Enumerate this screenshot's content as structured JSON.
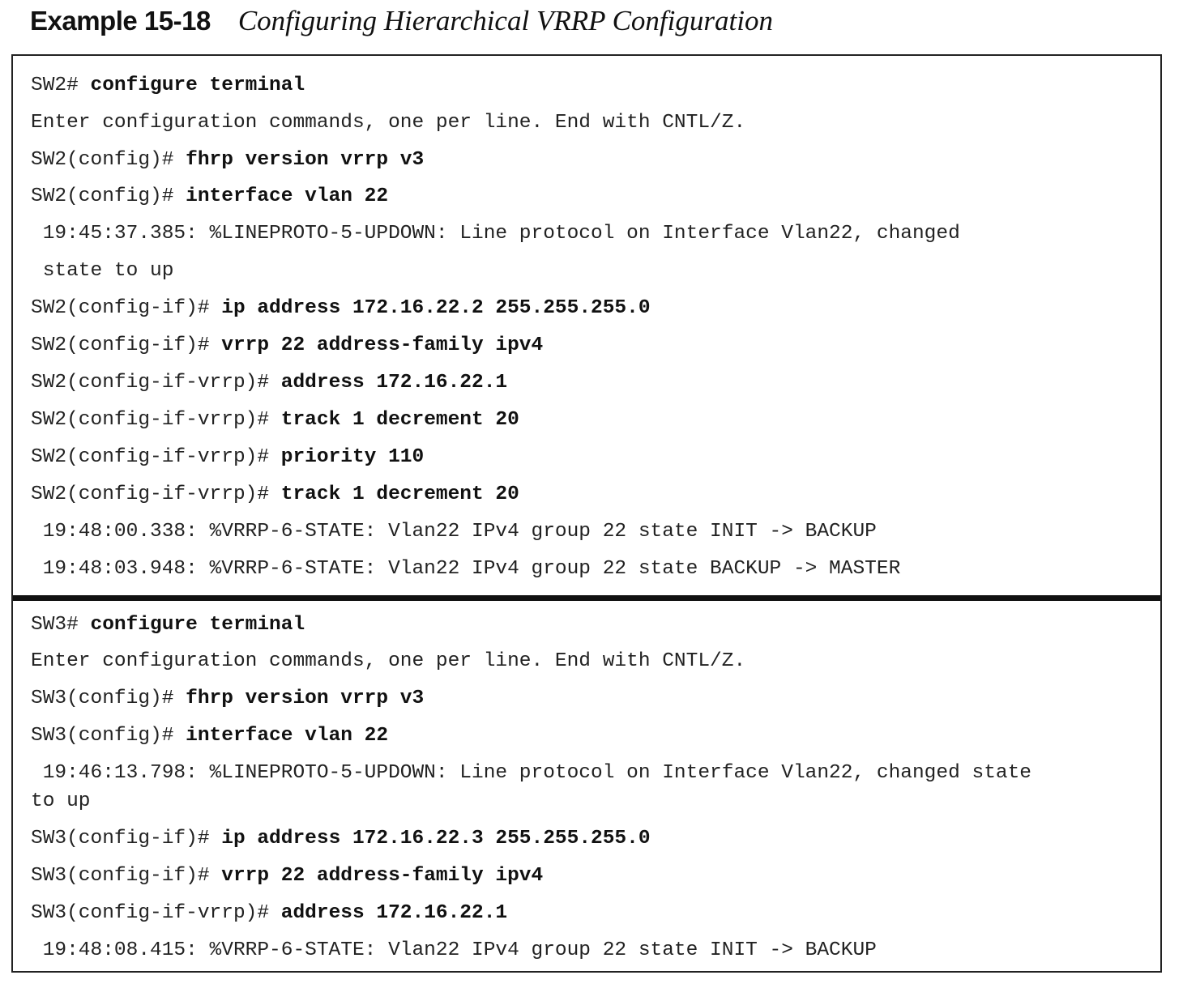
{
  "caption": {
    "label": "Example 15-18",
    "title": "Configuring Hierarchical VRRP Configuration"
  },
  "sw2": {
    "l1": {
      "prompt": "SW2# ",
      "cmd": "configure terminal"
    },
    "l2": {
      "text": "Enter configuration commands, one per line. End with CNTL/Z."
    },
    "l3": {
      "prompt": "SW2(config)# ",
      "cmd": "fhrp version vrrp v3"
    },
    "l4": {
      "prompt": "SW2(config)# ",
      "cmd": "interface vlan 22"
    },
    "l5": {
      "text": " 19:45:37.385: %LINEPROTO-5-UPDOWN: Line protocol on Interface Vlan22, changed"
    },
    "l6": {
      "text": " state to up"
    },
    "l7": {
      "prompt": "SW2(config-if)# ",
      "cmd": "ip address 172.16.22.2 255.255.255.0"
    },
    "l8": {
      "prompt": "SW2(config-if)# ",
      "cmd": "vrrp 22 address-family ipv4"
    },
    "l9": {
      "prompt": "SW2(config-if-vrrp)# ",
      "cmd": "address 172.16.22.1"
    },
    "l10": {
      "prompt": "SW2(config-if-vrrp)# ",
      "cmd": "track 1 decrement 20"
    },
    "l11": {
      "prompt": "SW2(config-if-vrrp)# ",
      "cmd": "priority 110"
    },
    "l12": {
      "prompt": "SW2(config-if-vrrp)# ",
      "cmd": "track 1 decrement 20"
    },
    "l13": {
      "text": " 19:48:00.338: %VRRP-6-STATE: Vlan22 IPv4 group 22 state INIT -> BACKUP"
    },
    "l14": {
      "text": " 19:48:03.948: %VRRP-6-STATE: Vlan22 IPv4 group 22 state BACKUP -> MASTER"
    }
  },
  "sw3": {
    "l1": {
      "prompt": "SW3# ",
      "cmd": "configure terminal"
    },
    "l2": {
      "text": "Enter configuration commands, one per line. End with CNTL/Z."
    },
    "l3": {
      "prompt": "SW3(config)# ",
      "cmd": "fhrp version vrrp v3"
    },
    "l4": {
      "prompt": "SW3(config)# ",
      "cmd": "interface vlan 22"
    },
    "l5": {
      "text": " 19:46:13.798: %LINEPROTO-5-UPDOWN: Line protocol on Interface Vlan22, changed state\nto up"
    },
    "l6": {
      "prompt": "SW3(config-if)# ",
      "cmd": "ip address 172.16.22.3 255.255.255.0"
    },
    "l7": {
      "prompt": "SW3(config-if)# ",
      "cmd": "vrrp 22 address-family ipv4"
    },
    "l8": {
      "prompt": "SW3(config-if-vrrp)# ",
      "cmd": "address 172.16.22.1"
    },
    "l9": {
      "text": " 19:48:08.415: %VRRP-6-STATE: Vlan22 IPv4 group 22 state INIT -> BACKUP"
    }
  }
}
